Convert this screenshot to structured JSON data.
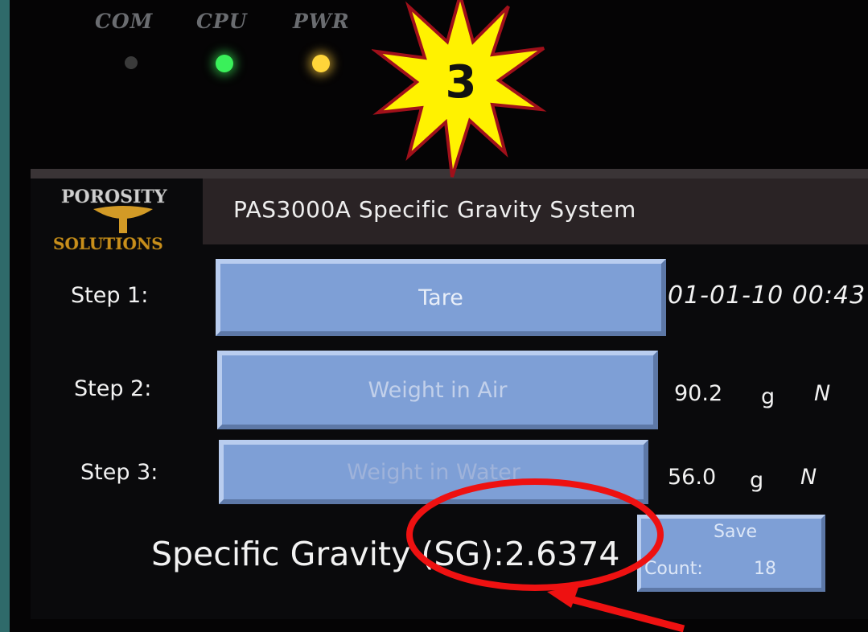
{
  "indicators": [
    {
      "label": "COM",
      "state": "off",
      "color": "#3a3a3a"
    },
    {
      "label": "CPU",
      "state": "on",
      "color": "#3af05a"
    },
    {
      "label": "PWR",
      "state": "on",
      "color": "#ffd53a"
    }
  ],
  "annotation": {
    "number": "3"
  },
  "logo": {
    "text_top": "POROSITY",
    "text_bottom": "SOLUTIONS"
  },
  "header": {
    "title": "PAS3000A  Specific Gravity System"
  },
  "steps": [
    {
      "label": "Step 1:",
      "button": "Tare",
      "readout": "01-01-10 00:43"
    },
    {
      "label": "Step 2:",
      "button": "Weight in Air",
      "value": "90.2",
      "unit": "g",
      "flag": "N"
    },
    {
      "label": "Step 3:",
      "button": "Weight in Water",
      "value": "56.0",
      "unit": "g",
      "flag": "N"
    }
  ],
  "result": {
    "label": "Specific Gravity (SG):2.6374"
  },
  "save": {
    "label": "Save",
    "count_label": "Count:",
    "count_value": "18"
  }
}
